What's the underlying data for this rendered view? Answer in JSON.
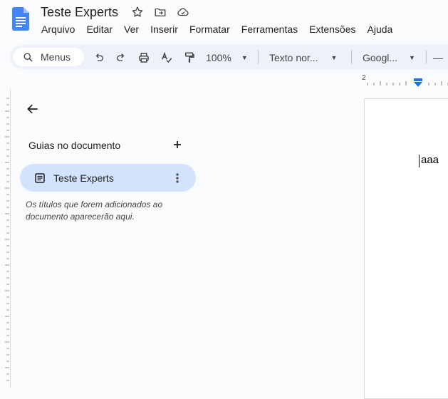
{
  "app": {
    "document_title": "Teste Experts"
  },
  "menu": [
    "Arquivo",
    "Editar",
    "Ver",
    "Inserir",
    "Formatar",
    "Ferramentas",
    "Extensões",
    "Ajuda"
  ],
  "toolbar": {
    "search_placeholder": "Menus",
    "zoom": "100%",
    "style": "Texto nor...",
    "font": "Googl...",
    "font_size_minus": "—"
  },
  "ruler": {
    "tick_label": "2"
  },
  "sidebar": {
    "heading": "Guias no documento",
    "tabs": [
      {
        "label": "Teste Experts",
        "selected": true
      }
    ],
    "hint": "Os títulos que forem adicionados ao documento aparecerão aqui."
  },
  "document": {
    "body_text": "aaa"
  },
  "colors": {
    "doc_icon_blue": "#4285f4",
    "selected_tab_bg": "#d3e3fd",
    "toolbar_bg": "#edf2fa",
    "ruler_indent_marker": "#1a73e8"
  }
}
